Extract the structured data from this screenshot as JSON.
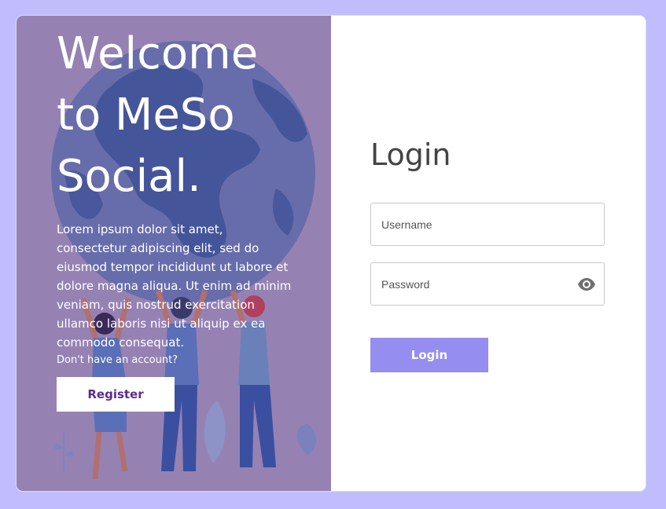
{
  "colors": {
    "page_background": "#c1bdfd",
    "left_panel": "#9582b3",
    "illustration_blue": "#5a66a8",
    "register_text": "#5b2d8e",
    "login_button": "#958ef0",
    "title_text": "#444444"
  },
  "left": {
    "welcome_line1": "Welcome",
    "welcome_line2": "to MeSo",
    "welcome_line3": "Social.",
    "lorem": "Lorem ipsum dolor sit amet, consectetur adipiscing elit, sed do eiusmod tempor incididunt ut labore et dolore magna aliqua. Ut enim ad minim veniam, quis nostrud exercitation ullamco laboris nisi ut aliquip ex ea commodo consequat.",
    "no_account": "Don't have an account?",
    "register_label": "Register",
    "illustration": "globe-and-people-illustration"
  },
  "right": {
    "title": "Login",
    "username_placeholder": "Username",
    "password_placeholder": "Password",
    "show_password_icon": "eye-icon",
    "login_label": "Login"
  }
}
